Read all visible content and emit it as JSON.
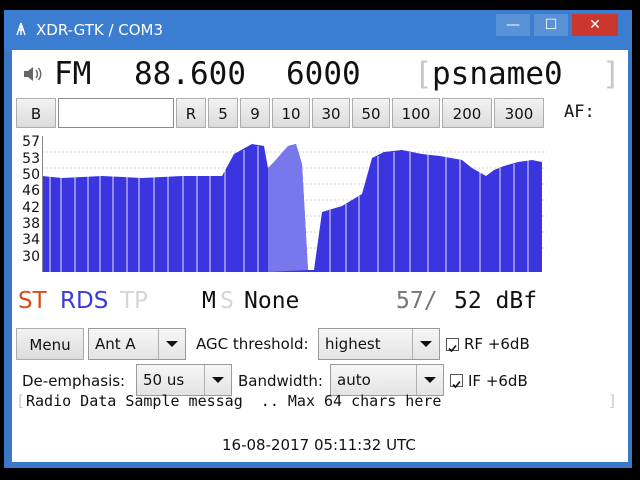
{
  "window": {
    "title": "XDR-GTK / COM3",
    "minimize_glyph": "—",
    "maximize_glyph": "☐",
    "close_glyph": "✕"
  },
  "tuner": {
    "band": "FM",
    "frequency": "88.600",
    "pi_code": "6000",
    "bracket_open": "[",
    "ps_name": "psname0",
    "bracket_close": "]"
  },
  "buttons": {
    "b_label": "B",
    "r_label": "R",
    "steps": [
      "5",
      "9",
      "10",
      "30",
      "50",
      "100",
      "200",
      "300"
    ],
    "af_label": "AF:"
  },
  "graph": {
    "y_ticks": [
      "57",
      "53",
      "50",
      "46",
      "42",
      "38",
      "34",
      "30"
    ],
    "bar_color": "#3b35e0",
    "fade_color": "#8e8ef0"
  },
  "status": {
    "st": "ST",
    "rds": "RDS",
    "tp": "TP",
    "m": "M",
    "s": "S",
    "pty": "None",
    "signal_max": "57/",
    "signal_now": "52 dBf",
    "st_color": "#d84d18",
    "rds_color": "#3a3ad8",
    "tp_color": "#d6d6d6"
  },
  "controls": {
    "menu_label": "Menu",
    "antenna_value": "Ant A",
    "agc_label": "AGC threshold:",
    "agc_value": "highest",
    "rf_label": "RF +6dB",
    "deemph_label": "De-emphasis:",
    "deemph_value": "50 us",
    "bandwidth_label": "Bandwidth:",
    "bandwidth_value": "auto",
    "if_label": "IF +6dB"
  },
  "rds_text": {
    "open": "[",
    "text": "Radio Data Sample messag  .. Max 64 chars here",
    "close": "]"
  },
  "clock": "16-08-2017 05:11:32 UTC"
}
